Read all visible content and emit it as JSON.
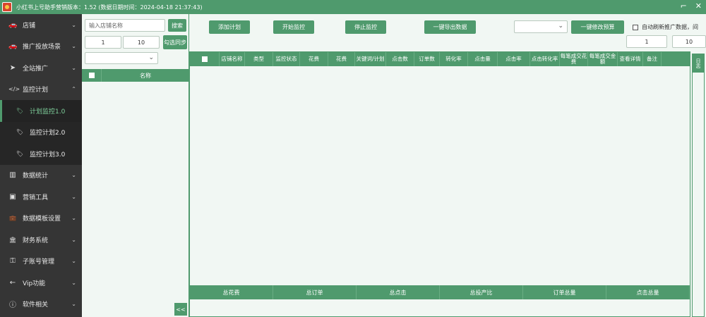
{
  "window": {
    "title": "小红书上号助手营销版本：1.52 (数据日期时间：2024-04-18 21:37:43)",
    "min_label": "⌐",
    "close_label": "✕"
  },
  "sidebar": {
    "items": [
      {
        "icon": "car-icon",
        "glyph": "🚗",
        "label": "店铺"
      },
      {
        "icon": "car-icon",
        "glyph": "🚗",
        "label": "推广投放场景"
      },
      {
        "icon": "send-icon",
        "glyph": "➤",
        "label": "全站推广"
      },
      {
        "icon": "code-icon",
        "glyph": "</>",
        "label": "监控计划"
      },
      {
        "icon": "tag-icon",
        "glyph": "🏷",
        "label": "计划监控1.0"
      },
      {
        "icon": "tag-icon",
        "glyph": "🏷",
        "label": "监控计划2.0"
      },
      {
        "icon": "tag-icon",
        "glyph": "🏷",
        "label": "监控计划3.0"
      },
      {
        "icon": "bar-chart-icon",
        "glyph": "▥",
        "label": "数据统计"
      },
      {
        "icon": "contact-icon",
        "glyph": "▣",
        "label": "营销工具"
      },
      {
        "icon": "briefcase-icon",
        "glyph": "💼",
        "label": "数据模板设置"
      },
      {
        "icon": "bank-icon",
        "glyph": "🏛",
        "label": "财务系统"
      },
      {
        "icon": "key-icon",
        "glyph": "⚿",
        "label": "子账号管理"
      },
      {
        "icon": "arrow-left-icon",
        "glyph": "←",
        "label": "Vip功能"
      },
      {
        "icon": "info-icon",
        "glyph": "ⓘ",
        "label": "软件相关"
      }
    ]
  },
  "mid": {
    "search_placeholder": "输入店铺名称",
    "search_button": "搜索",
    "page_from": "1",
    "page_to": "10",
    "sync_button": "勾选同步",
    "select_value": "",
    "col_name": "名称",
    "collapse_label": "<<"
  },
  "toolbar": {
    "btn1": "添加计划",
    "btn2": "开始监控",
    "btn3": "停止监控",
    "btn4": "一键导出数据",
    "select_value": "",
    "btn5": "一键修改预算",
    "auto_refresh": "自动刷新推广数据，间",
    "page_from": "1",
    "page_to": "10"
  },
  "table": {
    "headers": [
      "店铺名称",
      "类型",
      "监控状态",
      "花费",
      "花费",
      "关键词/计划",
      "点击数",
      "订单数",
      "转化率",
      "点击量",
      "点击率",
      "点击转化率",
      "每笔成交花费",
      "每笔成交金额",
      "查看详情",
      "备注"
    ],
    "footer": [
      "总花费",
      "总订单",
      "总点击",
      "总投产比",
      "订单总量",
      "点击总量"
    ]
  },
  "right_tab": {
    "label": "日志"
  }
}
